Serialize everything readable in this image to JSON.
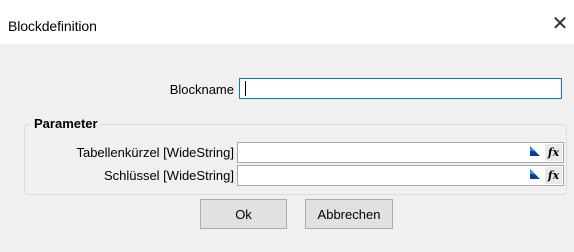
{
  "window": {
    "title": "Blockdefinition",
    "close_glyph": "✕"
  },
  "form": {
    "blockname_label": "Blockname",
    "blockname_value": ""
  },
  "parameters": {
    "group_title": "Parameter",
    "rows": [
      {
        "label": "Tabellenkürzel [WideString]",
        "value": "",
        "fx": "fx"
      },
      {
        "label": "Schlüssel [WideString]",
        "value": "",
        "fx": "fx"
      }
    ]
  },
  "buttons": {
    "ok": "Ok",
    "cancel": "Abbrechen"
  }
}
